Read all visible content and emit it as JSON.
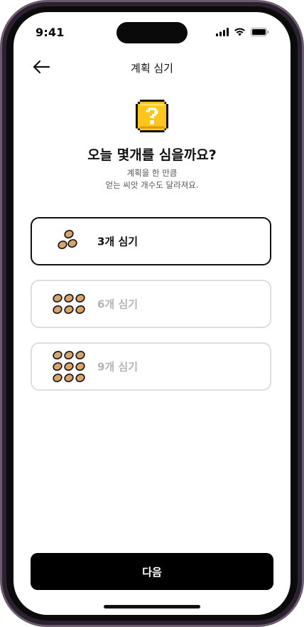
{
  "status_bar": {
    "time": "9:41"
  },
  "header": {
    "title": "계획 심기"
  },
  "main": {
    "headline": "오늘 몇개를 심을까요?",
    "subtext_line1": "계획을 한 만큼",
    "subtext_line2": "얻는 씨앗 개수도 달라져요."
  },
  "options": [
    {
      "label": "3개 심기",
      "seeds": 3,
      "selected": true
    },
    {
      "label": "6개 심기",
      "seeds": 6,
      "selected": false
    },
    {
      "label": "9개 심기",
      "seeds": 9,
      "selected": false
    }
  ],
  "footer": {
    "next_label": "다음"
  },
  "colors": {
    "accent": "#000000",
    "seed": "#d9a46a",
    "question_block": "#ffc61a"
  }
}
